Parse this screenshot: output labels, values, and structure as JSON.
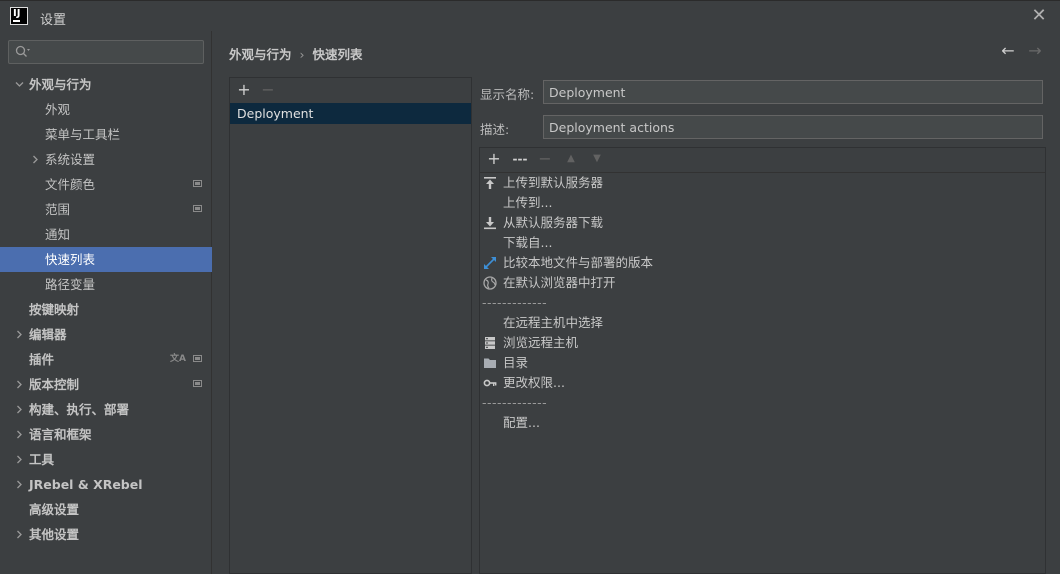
{
  "window": {
    "title": "设置",
    "logo_text": "IJ"
  },
  "search": {
    "placeholder": "",
    "value": ""
  },
  "sidebar": {
    "items": [
      {
        "label": "外观与行为",
        "level": 0,
        "expander": "open",
        "bold": true,
        "badge": false,
        "selected": false
      },
      {
        "label": "外观",
        "level": 1,
        "expander": "none",
        "bold": false,
        "badge": false,
        "selected": false
      },
      {
        "label": "菜单与工具栏",
        "level": 1,
        "expander": "none",
        "bold": false,
        "badge": false,
        "selected": false
      },
      {
        "label": "系统设置",
        "level": 1,
        "expander": "closed",
        "bold": false,
        "badge": false,
        "selected": false
      },
      {
        "label": "文件颜色",
        "level": 1,
        "expander": "none",
        "bold": false,
        "badge": true,
        "selected": false
      },
      {
        "label": "范围",
        "level": 1,
        "expander": "none",
        "bold": false,
        "badge": true,
        "selected": false
      },
      {
        "label": "通知",
        "level": 1,
        "expander": "none",
        "bold": false,
        "badge": false,
        "selected": false
      },
      {
        "label": "快速列表",
        "level": 1,
        "expander": "none",
        "bold": false,
        "badge": false,
        "selected": true
      },
      {
        "label": "路径变量",
        "level": 1,
        "expander": "none",
        "bold": false,
        "badge": false,
        "selected": false
      },
      {
        "label": "按键映射",
        "level": 0,
        "expander": "none",
        "bold": true,
        "badge": false,
        "selected": false
      },
      {
        "label": "编辑器",
        "level": 0,
        "expander": "closed",
        "bold": true,
        "badge": false,
        "selected": false
      },
      {
        "label": "插件",
        "level": 0,
        "expander": "none",
        "bold": true,
        "badge": true,
        "translate": true,
        "selected": false
      },
      {
        "label": "版本控制",
        "level": 0,
        "expander": "closed",
        "bold": true,
        "badge": true,
        "selected": false
      },
      {
        "label": "构建、执行、部署",
        "level": 0,
        "expander": "closed",
        "bold": true,
        "badge": false,
        "selected": false
      },
      {
        "label": "语言和框架",
        "level": 0,
        "expander": "closed",
        "bold": true,
        "badge": false,
        "selected": false
      },
      {
        "label": "工具",
        "level": 0,
        "expander": "closed",
        "bold": true,
        "badge": false,
        "selected": false
      },
      {
        "label": "JRebel & XRebel",
        "level": 0,
        "expander": "closed",
        "bold": true,
        "badge": false,
        "selected": false
      },
      {
        "label": "高级设置",
        "level": 0,
        "expander": "none",
        "bold": true,
        "badge": false,
        "selected": false
      },
      {
        "label": "其他设置",
        "level": 0,
        "expander": "closed",
        "bold": true,
        "badge": false,
        "selected": false
      }
    ]
  },
  "breadcrumb": {
    "parent": "外观与行为",
    "separator": "›",
    "current": "快速列表"
  },
  "nav": {
    "back": "←",
    "forward": "→"
  },
  "list_toolbar": {
    "add": "+",
    "remove": "−"
  },
  "quick_lists": [
    {
      "label": "Deployment",
      "selected": true
    }
  ],
  "form": {
    "display_name_label": "显示名称:",
    "display_name_value": "Deployment",
    "description_label": "描述:",
    "description_value": "Deployment actions"
  },
  "actions_toolbar": {
    "add": "+",
    "separator": "---",
    "remove": "−",
    "up": "▲",
    "down": "▼"
  },
  "actions": [
    {
      "label": "上传到默认服务器",
      "icon": "upload-icon",
      "separator": false
    },
    {
      "label": "上传到...",
      "icon": "",
      "separator": false
    },
    {
      "label": "从默认服务器下载",
      "icon": "download-icon",
      "separator": false
    },
    {
      "label": "下载自...",
      "icon": "",
      "separator": false
    },
    {
      "label": "比较本地文件与部署的版本",
      "icon": "compare-icon",
      "separator": false
    },
    {
      "label": "在默认浏览器中打开",
      "icon": "globe-icon",
      "separator": false
    },
    {
      "label": "-------------",
      "icon": "",
      "separator": true
    },
    {
      "label": "在远程主机中选择",
      "icon": "",
      "separator": false
    },
    {
      "label": "浏览远程主机",
      "icon": "server-icon",
      "separator": false
    },
    {
      "label": "目录",
      "icon": "folder-icon",
      "separator": false
    },
    {
      "label": "更改权限...",
      "icon": "key-icon",
      "separator": false
    },
    {
      "label": "-------------",
      "icon": "",
      "separator": true
    },
    {
      "label": "配置...",
      "icon": "",
      "separator": false
    }
  ],
  "colors": {
    "selection": "#4b6eaf",
    "list_selection": "#0d293e",
    "background": "#3c3f41",
    "accent_compare": "#3d8fd6"
  }
}
